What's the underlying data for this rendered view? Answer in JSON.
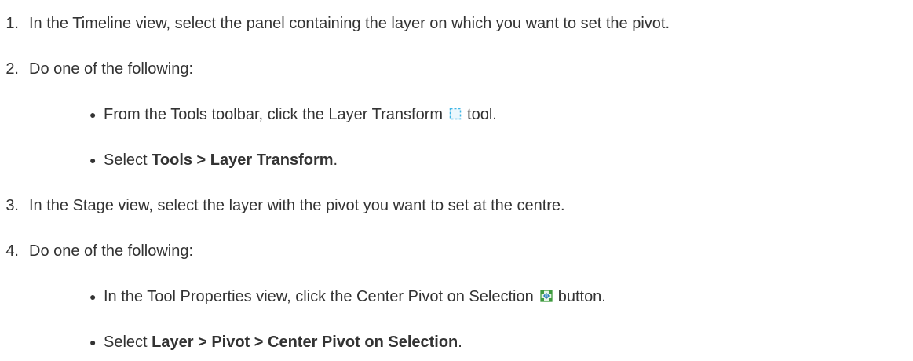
{
  "steps": [
    {
      "number": "1.",
      "text": "In the Timeline view, select the panel containing the layer on which you want to set the pivot."
    },
    {
      "number": "2.",
      "text": "Do one of the following:",
      "options": [
        {
          "before": "From the Tools toolbar, click the Layer Transform",
          "icon": "layer-transform-icon",
          "after": "tool."
        },
        {
          "prefix": "Select ",
          "menu_path": "Tools > Layer Transform",
          "suffix": "."
        }
      ]
    },
    {
      "number": "3.",
      "text": "In the Stage view, select the layer with the pivot you want to set at the centre."
    },
    {
      "number": "4.",
      "text": "Do one of the following:",
      "options": [
        {
          "before": "In the Tool Properties view, click the Center Pivot on Selection",
          "icon": "center-pivot-on-selection-icon",
          "after": "button."
        },
        {
          "prefix": "Select ",
          "menu_path": "Layer > Pivot > Center Pivot on Selection",
          "suffix": "."
        }
      ]
    }
  ],
  "bullet_glyph": "●",
  "colors": {
    "text": "#333333",
    "layer_transform_icon": "#3fb6e6",
    "center_pivot_icon": "#3f9a3f"
  }
}
